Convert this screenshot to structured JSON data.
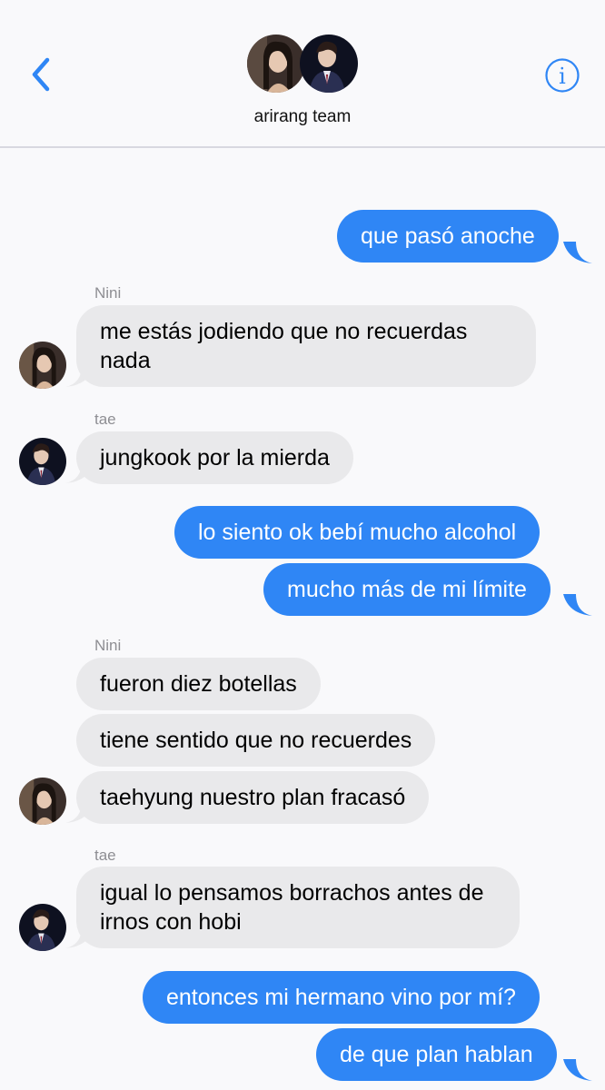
{
  "header": {
    "group_name": "arirang team",
    "back_icon": "chevron-left-icon",
    "info_icon": "info-circle-icon",
    "accent": "#2f86f5"
  },
  "participants": [
    {
      "name": "Nini"
    },
    {
      "name": "tae"
    }
  ],
  "messages": [
    {
      "from": "me",
      "text": "que pasó anoche"
    },
    {
      "from": "Nini",
      "text": "me estás jodiendo que no recuerdas nada"
    },
    {
      "from": "tae",
      "text": "jungkook por la mierda"
    },
    {
      "from": "me",
      "text": "lo siento ok bebí mucho alcohol"
    },
    {
      "from": "me",
      "text": "mucho más de mi límite"
    },
    {
      "from": "Nini",
      "text": "fueron diez botellas"
    },
    {
      "from": "Nini",
      "text": "tiene sentido que no recuerdes"
    },
    {
      "from": "Nini",
      "text": "taehyung nuestro plan fracasó"
    },
    {
      "from": "tae",
      "text": "igual lo pensamos borrachos antes de irnos con hobi"
    },
    {
      "from": "me",
      "text": "entonces mi hermano vino por mí?"
    },
    {
      "from": "me",
      "text": "de que plan hablan"
    }
  ],
  "colors": {
    "outgoing_bubble": "#2f86f5",
    "incoming_bubble": "#e9e9eb",
    "sender_label": "#8e8e93"
  }
}
